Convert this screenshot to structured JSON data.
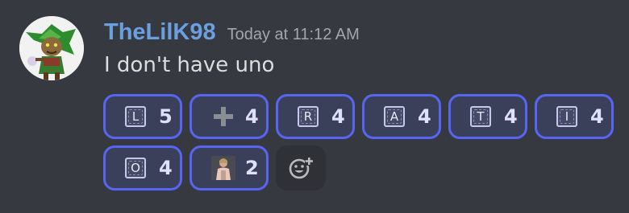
{
  "message": {
    "author": "TheLilK98",
    "timestamp": "Today at 11:12 AM",
    "content": "I don't have uno",
    "avatar_icon": "goblin-character-avatar"
  },
  "reactions": [
    {
      "emoji_type": "regional-letter",
      "letter": "L",
      "count": "5"
    },
    {
      "emoji_type": "heavy-plus-sign",
      "count": "4"
    },
    {
      "emoji_type": "regional-letter",
      "letter": "R",
      "count": "4"
    },
    {
      "emoji_type": "regional-letter",
      "letter": "A",
      "count": "4"
    },
    {
      "emoji_type": "regional-letter",
      "letter": "T",
      "count": "4"
    },
    {
      "emoji_type": "regional-letter",
      "letter": "I",
      "count": "4"
    },
    {
      "emoji_type": "regional-letter",
      "letter": "O",
      "count": "4"
    },
    {
      "emoji_type": "custom-photo",
      "count": "2"
    }
  ],
  "add_reaction_icon": "add-reaction-icon",
  "colors": {
    "background": "#36393f",
    "username": "#6a9fe0",
    "reaction_bg": "#3b405a",
    "reaction_border": "#5865f2"
  }
}
